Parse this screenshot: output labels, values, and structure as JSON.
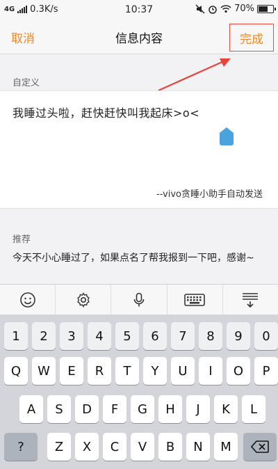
{
  "status_bar": {
    "network": "4G",
    "speed": "0.3K/s",
    "time": "10:37",
    "battery": "70%",
    "battery_level": 0.7
  },
  "nav": {
    "cancel": "取消",
    "title": "信息内容",
    "done": "完成"
  },
  "custom": {
    "label": "自定义",
    "message": "我睡过头啦，赶快赶快叫我起床>o<",
    "signature": "--vivo贪睡小助手自动发送"
  },
  "recommend": {
    "label": "推荐",
    "text": "今天不小心睡过了，如果点名了帮我报到一下吧，感谢~"
  },
  "keyboard": {
    "toolbar": [
      "emoji-icon",
      "settings-gear-icon",
      "microphone-icon",
      "keyboard-icon",
      "collapse-keyboard-icon"
    ],
    "rows": [
      [
        "1",
        "2",
        "3",
        "4",
        "5",
        "6",
        "7",
        "8",
        "9",
        "0"
      ],
      [
        "Q",
        "W",
        "E",
        "R",
        "T",
        "Y",
        "U",
        "I",
        "O",
        "P"
      ],
      [
        "A",
        "S",
        "D",
        "F",
        "G",
        "H",
        "J",
        "K",
        "L"
      ],
      [
        "?",
        "Z",
        "X",
        "C",
        "V",
        "B",
        "N",
        "M"
      ]
    ],
    "backspace_icon": "backspace-icon"
  },
  "colors": {
    "accent": "#f08a24",
    "highlight_box": "#e84a3b",
    "cursor_handle": "#4aa3df"
  }
}
